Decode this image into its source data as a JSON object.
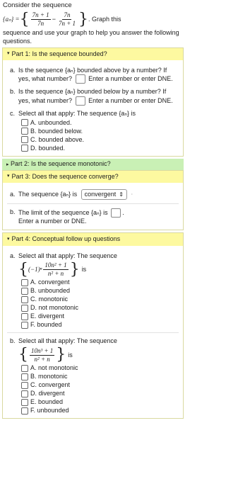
{
  "intro": {
    "line1": "Consider the sequence",
    "seq_symbol": "{aₙ} =",
    "frac1_num": "7n + 1",
    "frac1_den": "7n",
    "minus": "−",
    "frac2_num": "7n",
    "frac2_den": "7n + 1",
    "graph_text": ". Graph this",
    "line3": "sequence and use your graph to help you answer the following questions."
  },
  "part1": {
    "header": "Part 1: Is the sequence bounded?",
    "qa": {
      "label": "a.",
      "text": "Is the sequence {aₙ} bounded above by a number? If yes, what number?",
      "after": "Enter a number or enter DNE."
    },
    "qb": {
      "label": "b.",
      "text": "Is the sequence {aₙ} bounded below by a number? If yes, what number?",
      "after": "Enter a number or enter DNE."
    },
    "qc": {
      "label": "c.",
      "text": "Select all that apply: The sequence {aₙ} is",
      "options": [
        "A. unbounded.",
        "B. bounded below.",
        "C. bounded above.",
        "D. bounded."
      ]
    }
  },
  "part2": {
    "header": "Part 2: Is the sequence monotonic?"
  },
  "part3": {
    "header": "Part 3: Does the sequence converge?",
    "qa": {
      "label": "a.",
      "text": "The sequence {aₙ} is",
      "select_value": "convergent"
    },
    "qb": {
      "label": "b.",
      "text": "The limit of the sequence {aₙ} is",
      "after": "Enter a number or DNE."
    }
  },
  "part4": {
    "header": "Part 4: Conceptual follow up questions",
    "qa": {
      "label": "a.",
      "text": "Select all that apply: The sequence",
      "factor": "(−1)ⁿ",
      "frac_num": "10n² + 1",
      "frac_den": "n² + n",
      "is": "is",
      "options": [
        "A. convergent",
        "B. unbounded",
        "C. monotonic",
        "D. not monotonic",
        "E. divergent",
        "F. bounded"
      ]
    },
    "qb": {
      "label": "b.",
      "text": "Select all that apply: The sequence",
      "frac_num": "10n³ + 1",
      "frac_den": "n² + n",
      "is": "is",
      "options": [
        "A. not monotonic",
        "B. monotonic",
        "C. convergent",
        "D. divergent",
        "E. bounded",
        "F. unbounded"
      ]
    }
  }
}
